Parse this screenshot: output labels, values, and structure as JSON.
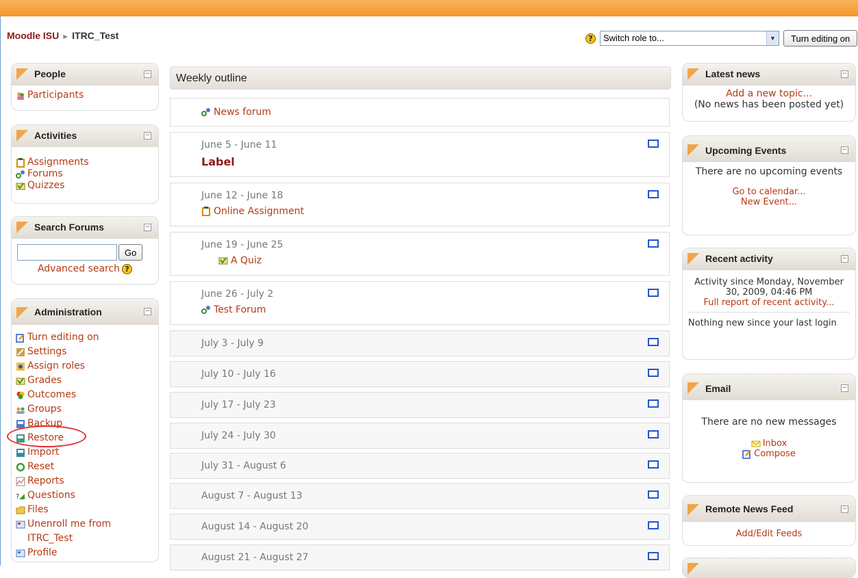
{
  "breadcrumb": {
    "home": "Moodle ISU",
    "course": "ITRC_Test"
  },
  "header": {
    "role_select_value": "Switch role to...",
    "turn_editing_label": "Turn editing on",
    "help_glyph": "?"
  },
  "people": {
    "title": "People",
    "participants": "Participants"
  },
  "activities": {
    "title": "Activities",
    "items": [
      "Assignments",
      "Forums",
      "Quizzes"
    ]
  },
  "search_forums": {
    "title": "Search Forums",
    "go": "Go",
    "advanced": "Advanced search"
  },
  "administration": {
    "title": "Administration",
    "items": [
      "Turn editing on",
      "Settings",
      "Assign roles",
      "Grades",
      "Outcomes",
      "Groups",
      "Backup",
      "Restore",
      "Import",
      "Reset",
      "Reports",
      "Questions",
      "Files",
      "Unenroll me from",
      "ITRC_Test",
      "Profile"
    ]
  },
  "outline": {
    "title": "Weekly outline",
    "news_forum": "News forum",
    "weeks": [
      {
        "date": "June 5 - June 11",
        "content": "Label"
      },
      {
        "date": "June 12 - June 18",
        "content": "Online Assignment"
      },
      {
        "date": "June 19 - June 25",
        "content": "A Quiz"
      },
      {
        "date": "June 26 - July 2",
        "content": "Test Forum"
      },
      {
        "date": "July 3 - July 9"
      },
      {
        "date": "July 10 - July 16"
      },
      {
        "date": "July 17 - July 23"
      },
      {
        "date": "July 24 - July 30"
      },
      {
        "date": "July 31 - August 6"
      },
      {
        "date": "August 7 - August 13"
      },
      {
        "date": "August 14 - August 20"
      },
      {
        "date": "August 21 - August 27"
      }
    ]
  },
  "latest_news": {
    "title": "Latest news",
    "add": "Add a new topic...",
    "none": "(No news has been posted yet)"
  },
  "upcoming": {
    "title": "Upcoming Events",
    "none": "There are no upcoming events",
    "calendar": "Go to calendar...",
    "new_event": "New Event..."
  },
  "recent": {
    "title": "Recent activity",
    "since": "Activity since Monday, November 30, 2009, 04:46 PM",
    "full_report": "Full report of recent activity...",
    "nothing": "Nothing new since your last login"
  },
  "email": {
    "title": "Email",
    "none": "There are no new messages",
    "inbox": "Inbox",
    "compose": "Compose"
  },
  "remote": {
    "title": "Remote News Feed",
    "add": "Add/Edit Feeds"
  },
  "colors": {
    "link": "#b53a14",
    "topbar": "#f59a2c",
    "label": "#8b1a1a",
    "highlight": "#e03030"
  }
}
